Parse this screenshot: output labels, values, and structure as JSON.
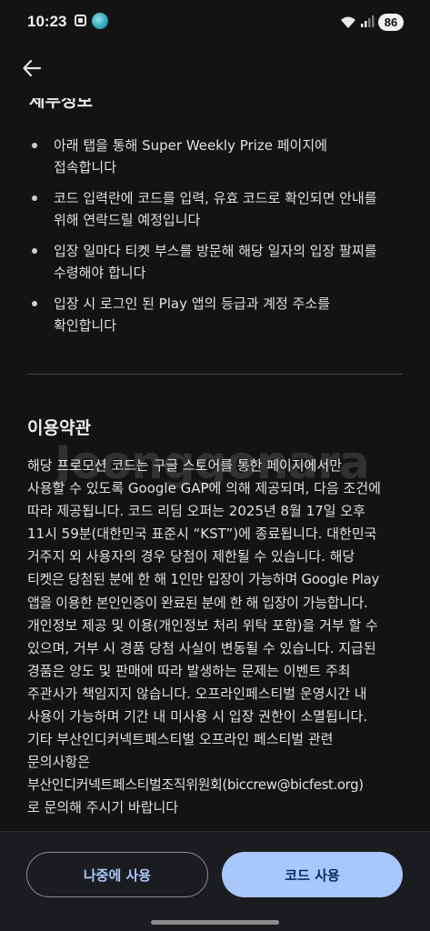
{
  "status_bar": {
    "time": "10:23",
    "battery": "86"
  },
  "top_bar": {
    "back_icon": "arrow-left-icon"
  },
  "event_info": {
    "section_title": "세부정보",
    "bullets": [
      [
        "아래 탭을 통해 Super Weekly Prize 페이지에",
        "접속합니다"
      ],
      [
        "코드 입력란에 코드를 입력, 유효 코드로 확인되면 안내를",
        "위해 연락드릴 예정입니다"
      ],
      [
        "입장 일마다 티켓 부스를 방문해 해당 일자의 입장 팔찌를",
        "수령해야 합니다"
      ],
      [
        "입장 시 로그인 된 Play 앱의 등급과 계정 주소를",
        "확인합니다"
      ]
    ]
  },
  "terms": {
    "title": "이용약관",
    "lines": [
      "해당 프로모션 코드는 구글 스토어를 통한 페이지에서만",
      "사용할 수 있도록 Google GAP에 의해 제공되며, 다음 조건에",
      "따라 제공됩니다. 코드 리딤 오퍼는 2025년 8월 17일 오후",
      "11시 59분(대한민국 표준시 “KST”)에 종료됩니다. 대한민국",
      "거주지 외 사용자의 경우 당첨이 제한될 수 있습니다. 해당",
      "티켓은 당첨된 분에 한 해 1인만 입장이 가능하며 Google Play",
      "앱을 이용한 본인인증이 완료된 분에 한 해 입장이 가능합니다.",
      "개인정보 제공 및 이용(개인정보 처리 위탁 포함)을 거부 할 수",
      "있으며, 거부 시 경품 당첨 사실이 변동될 수 있습니다. 지급된",
      "경품은 양도 및 판매에 따라 발생하는 문제는 이벤트 주최",
      "주관사가 책임지지 않습니다. 오프라인페스티벌 운영시간 내",
      "사용이 가능하며 기간 내 미사용 시 입장 권한이 소멸됩니다.",
      "기타 부산인디커넥트페스티벌 오프라인 페스티벌 관련",
      "문의사항은",
      "부산인디커넥트페스티벌조직위원회(biccrew@bicfest.org)",
      "로 문의해 주시기 바랍니다"
    ]
  },
  "watermark": "Joonggonara",
  "actions": {
    "later_label": "나중에 사용",
    "use_label": "코드 사용"
  },
  "colors": {
    "background": "#131313",
    "bottom_bar": "#1b1c20",
    "primary": "#a8c7fa",
    "on_primary": "#0a2a5c"
  }
}
